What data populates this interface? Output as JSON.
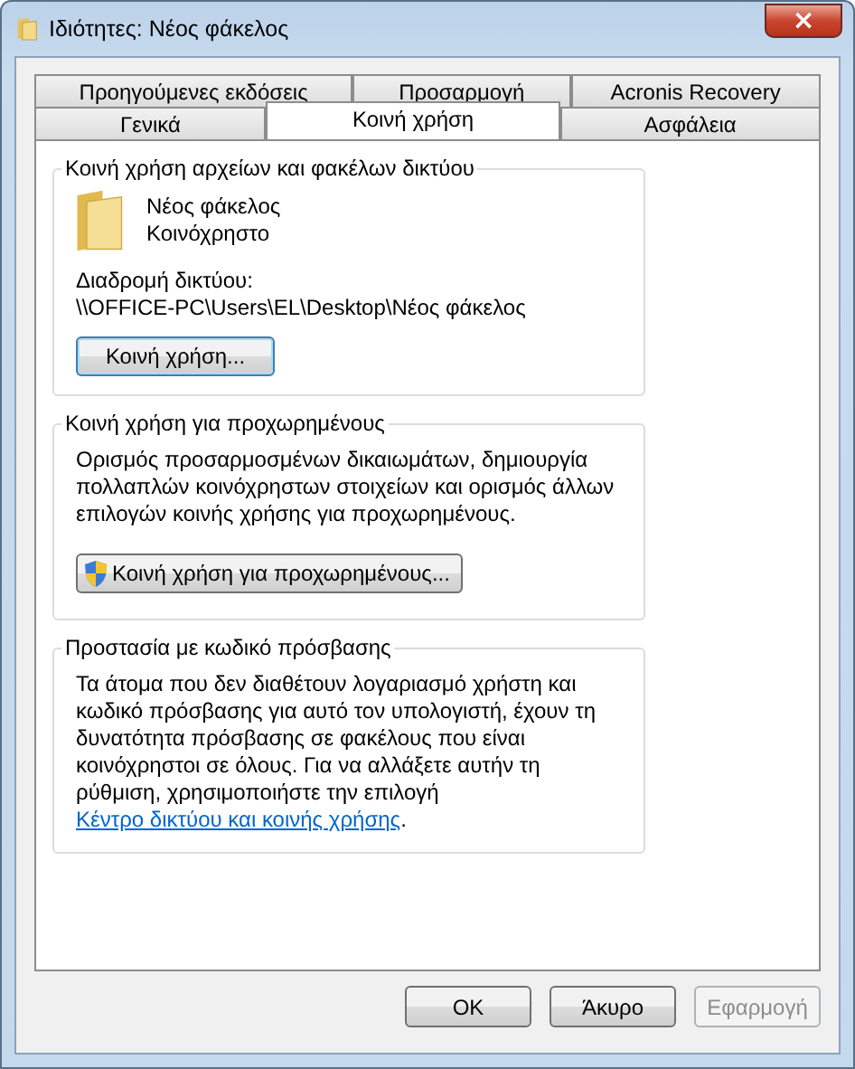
{
  "window": {
    "title": "Ιδιότητες: Νέος φάκελος",
    "close": "×"
  },
  "tab_rows": [
    [
      {
        "label": "Προηγούμενες εκδόσεις",
        "selected": false
      },
      {
        "label": "Προσαρμογή",
        "selected": false
      },
      {
        "label": "Acronis Recovery",
        "selected": false
      }
    ],
    [
      {
        "label": "Γενικά",
        "selected": false
      },
      {
        "label": "Κοινή χρήση",
        "selected": true
      },
      {
        "label": "Ασφάλεια",
        "selected": false
      }
    ]
  ],
  "network_sharing": {
    "title": "Κοινή χρήση αρχείων και φακέλων δικτύου",
    "folder_name": "Νέος φάκελος",
    "status": "Κοινόχρηστο",
    "path_label": "Διαδρομή δικτύου:",
    "path": "\\\\OFFICE-PC\\Users\\EL\\Desktop\\Νέος φάκελος",
    "button": "Κοινή χρήση..."
  },
  "advanced_sharing": {
    "title": "Κοινή χρήση για προχωρημένους",
    "description": "Ορισμός προσαρμοσμένων δικαιωμάτων, δημιουργία πολλαπλών κοινόχρηστων στοιχείων και ορισμός άλλων επιλογών κοινής χρήσης για προχωρημένους.",
    "button": "Κοινή χρήση για προχωρημένους..."
  },
  "password_protection": {
    "title": "Προστασία με κωδικό πρόσβασης",
    "text": "Τα άτομα που δεν διαθέτουν λογαριασμό χρήστη και κωδικό πρόσβασης για αυτό τον υπολογιστή, έχουν τη δυνατότητα πρόσβασης σε φακέλους που είναι κοινόχρηστοι σε όλους. Για να αλλάξετε αυτήν τη ρύθμιση, χρησιμοποιήστε την επιλογή",
    "link": "Κέντρο δικτύου και κοινής χρήσης",
    "after_link": "."
  },
  "buttons": [
    {
      "label": "OK",
      "disabled": false
    },
    {
      "label": "Άκυρο",
      "disabled": false
    },
    {
      "label": "Εφαρμογή",
      "disabled": true
    }
  ]
}
